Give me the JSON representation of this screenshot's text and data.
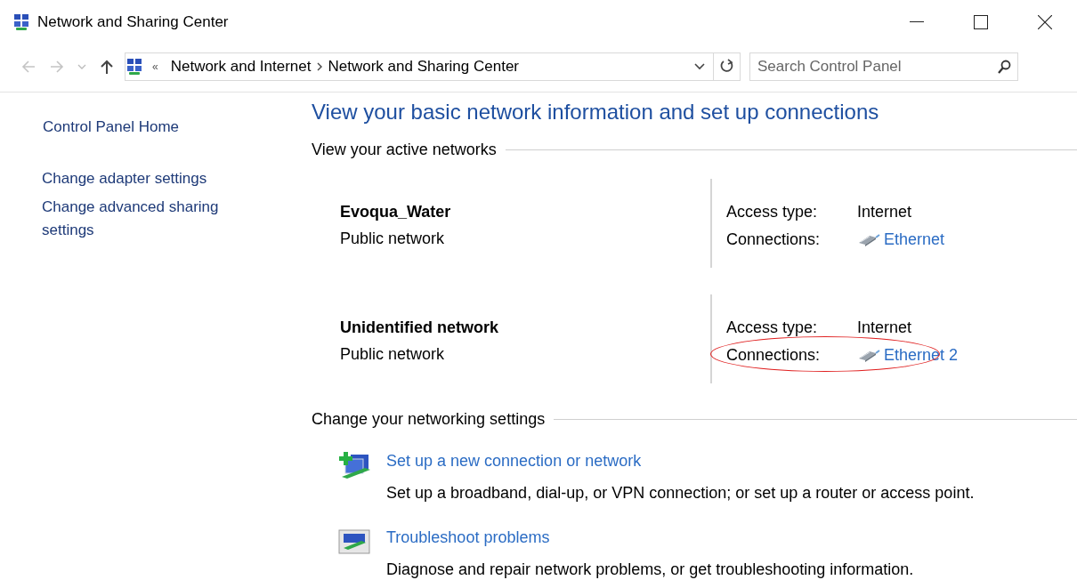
{
  "window": {
    "title": "Network and Sharing Center"
  },
  "nav": {
    "back": {
      "disabled": true
    },
    "forward": {
      "disabled": true
    },
    "up": {
      "disabled": false
    }
  },
  "address_bar": {
    "overflow": "«",
    "breadcrumbs": [
      "Network and Internet",
      "Network and Sharing Center"
    ]
  },
  "search": {
    "placeholder": "Search Control Panel"
  },
  "sidebar": {
    "items": [
      "Control Panel Home",
      "Change adapter settings",
      "Change advanced sharing settings"
    ]
  },
  "heading": "View your basic network information and set up connections",
  "active_networks": {
    "title": "View your active networks",
    "networks": [
      {
        "name": "Evoqua_Water",
        "category": "Public network",
        "access_label": "Access type:",
        "access_value": "Internet",
        "connections_label": "Connections:",
        "connection": "Ethernet",
        "highlighted": false
      },
      {
        "name": "Unidentified network",
        "category": "Public network",
        "access_label": "Access type:",
        "access_value": "Internet",
        "connections_label": "Connections:",
        "connection": "Ethernet 2",
        "highlighted": true
      }
    ]
  },
  "settings": {
    "title": "Change your networking settings",
    "tasks": [
      {
        "kind": "new-connection",
        "link": "Set up a new connection or network",
        "description": "Set up a broadband, dial-up, or VPN connection; or set up a router or access point."
      },
      {
        "kind": "troubleshoot",
        "link": "Troubleshoot problems",
        "description": "Diagnose and repair network problems, or get troubleshooting information."
      }
    ]
  }
}
